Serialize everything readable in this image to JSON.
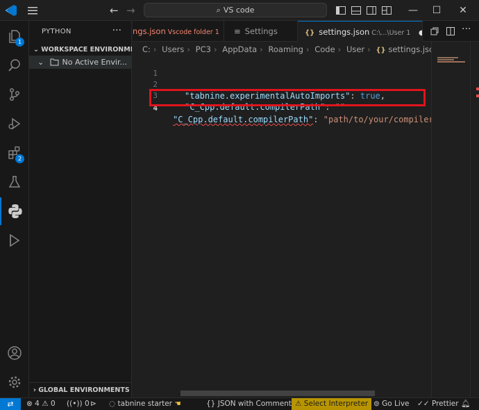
{
  "titlebar": {
    "search_text": "VS code",
    "back_arrow": "←",
    "forward_arrow": "→",
    "minimize": "—",
    "maximize": "☐",
    "close": "✕"
  },
  "activity": {
    "explorer_badge": "1",
    "extensions_badge": "2"
  },
  "sidebar": {
    "title": "PYTHON",
    "more": "···",
    "section": "WORKSPACE ENVIRONME...",
    "item": "No Active Envir...",
    "global": "GLOBAL ENVIRONMENTS"
  },
  "tabs": [
    {
      "label": "ngs.json",
      "desc": "Vscode folder 1"
    },
    {
      "label": "Settings",
      "desc": ""
    },
    {
      "label": "settings.json",
      "desc": "C:\\...\\User 1"
    }
  ],
  "breadcrumb": [
    "C:",
    "Users",
    "PC3",
    "AppData",
    "Roaming",
    "Code",
    "User",
    "settings.json",
    "..."
  ],
  "editor": {
    "lines": [
      {
        "num": "1",
        "text": ""
      },
      {
        "num": "2",
        "key": "\"tabnine.experimentalAutoImports\"",
        "colon": ": ",
        "value": "true",
        "trail": ","
      },
      {
        "num": "3",
        "key": "\"C_Cpp.default.compilerPath\"",
        "colon": ": ",
        "value": "\"\"",
        "trail": ""
      },
      {
        "num": "4",
        "key": "\"C_Cpp.default.compilerPath\"",
        "colon": ": ",
        "value": "\"path/to/your/compiler.\"",
        "trail": ""
      }
    ]
  },
  "status": {
    "errors": "4",
    "warnings": "0",
    "ports": "0",
    "tabnine": "tabnine starter",
    "language": "JSON with Comments",
    "interpreter": "Select Interpreter",
    "golive": "Go Live",
    "prettier": "Prettier"
  },
  "colors": {
    "accent": "#0078d4",
    "highlight_box": "#e0141d",
    "warning_bg": "#b89500"
  }
}
